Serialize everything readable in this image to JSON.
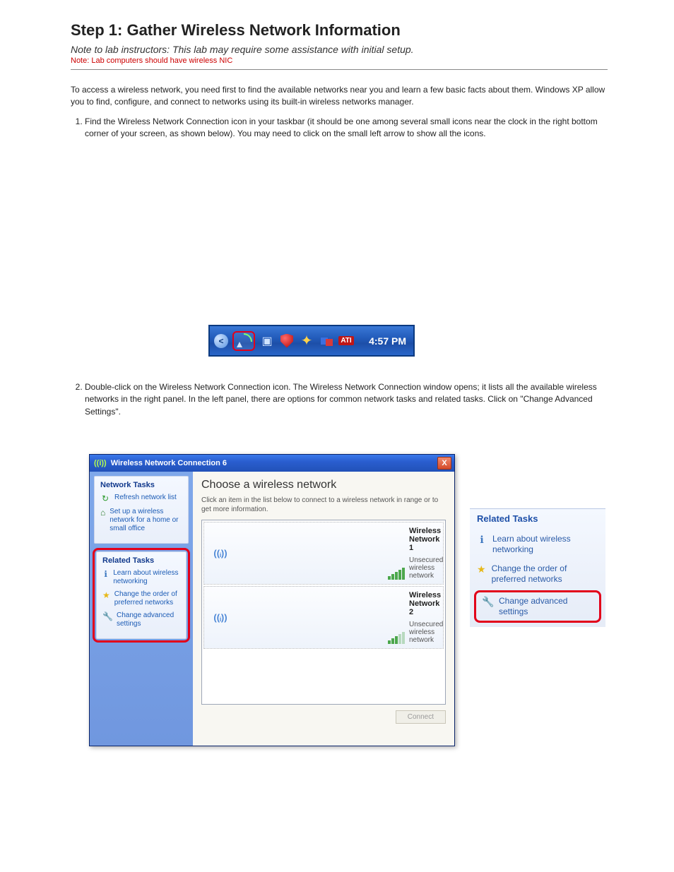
{
  "page": {
    "title": "Step 1: Gather Wireless Network Information",
    "subtitle": "Note to lab instructors: This lab may require some assistance with initial setup.",
    "note": "Note: Lab computers should have wireless NIC",
    "intro": "To access a wireless network, you need first to find the available networks near you and learn a few basic facts about them. Windows XP allow you to find, configure, and connect to networks using its built-in wireless networks manager.",
    "step1_pre": "Find the Wireless Network Connection icon in your taskbar (it should be one among several small icons near the clock in the right bottom corner of your screen, as shown below). You may need to click on the small left arrow to show all the icons.",
    "step2_pre": "Double-click on the Wireless Network Connection icon. The Wireless Network Connection window opens; it lists all the available wireless networks in the right panel. In the left panel, there are options for common network tasks and related tasks. Click on \"Change Advanced Settings\".",
    "steps": [
      "",
      ""
    ]
  },
  "systray": {
    "clock": "4:57 PM",
    "chevron": "<",
    "ati": "ATI"
  },
  "window": {
    "title": "Wireless Network Connection 6",
    "close": "X",
    "sidebar": {
      "network_tasks": {
        "title": "Network Tasks",
        "refresh": "Refresh network list",
        "setup": "Set up a wireless network for a home or small office"
      },
      "related_tasks": {
        "title": "Related Tasks",
        "learn": "Learn about wireless networking",
        "order": "Change the order of preferred networks",
        "advanced": "Change advanced settings"
      }
    },
    "main": {
      "heading": "Choose a wireless network",
      "sub": "Click an item in the list below to connect to a wireless network in range or to get more information.",
      "connect": "Connect",
      "networks": [
        {
          "name": "Wireless Network 1",
          "status": "Unsecured wireless network",
          "strength": 5
        },
        {
          "name": "Wireless Network 2",
          "status": "Unsecured wireless network",
          "strength": 3
        }
      ]
    }
  },
  "zoom": {
    "title": "Related Tasks",
    "learn": "Learn about wireless networking",
    "order": "Change the order of preferred networks",
    "advanced": "Change advanced settings"
  }
}
